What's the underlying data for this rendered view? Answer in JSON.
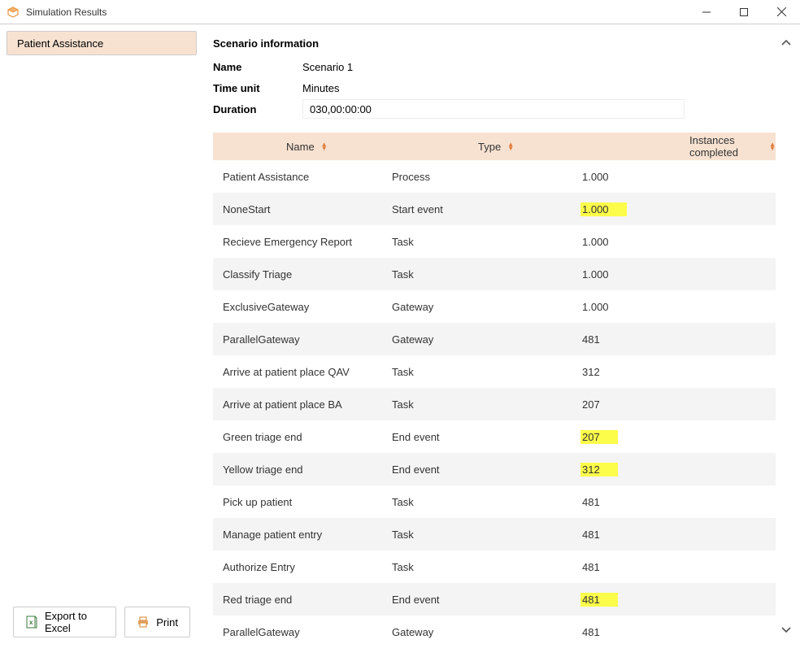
{
  "titlebar": {
    "title": "Simulation Results"
  },
  "sidebar": {
    "items": [
      {
        "label": "Patient Assistance",
        "selected": true
      }
    ]
  },
  "footer": {
    "export_label": "Export to Excel",
    "print_label": "Print"
  },
  "scenario": {
    "header": "Scenario information",
    "name_label": "Name",
    "name_value": "Scenario 1",
    "timeunit_label": "Time unit",
    "timeunit_value": "Minutes",
    "duration_label": "Duration",
    "duration_value": "030,00:00:00"
  },
  "table": {
    "headers": {
      "name": "Name",
      "type": "Type",
      "instances": "Instances completed"
    },
    "rows": [
      {
        "name": "Patient Assistance",
        "type": "Process",
        "instances": "1.000",
        "highlight": false
      },
      {
        "name": "NoneStart",
        "type": "Start event",
        "instances": "1.000",
        "highlight": true
      },
      {
        "name": "Recieve Emergency Report",
        "type": "Task",
        "instances": "1.000",
        "highlight": false
      },
      {
        "name": "Classify Triage",
        "type": "Task",
        "instances": "1.000",
        "highlight": false
      },
      {
        "name": "ExclusiveGateway",
        "type": "Gateway",
        "instances": "1.000",
        "highlight": false
      },
      {
        "name": "ParallelGateway",
        "type": "Gateway",
        "instances": "481",
        "highlight": false
      },
      {
        "name": "Arrive at patient place QAV",
        "type": "Task",
        "instances": "312",
        "highlight": false
      },
      {
        "name": "Arrive at patient place BA",
        "type": "Task",
        "instances": "207",
        "highlight": false
      },
      {
        "name": "Green triage end",
        "type": "End event",
        "instances": "207",
        "highlight": true
      },
      {
        "name": "Yellow triage end",
        "type": "End event",
        "instances": "312",
        "highlight": true
      },
      {
        "name": "Pick up patient",
        "type": "Task",
        "instances": "481",
        "highlight": false
      },
      {
        "name": "Manage patient entry",
        "type": "Task",
        "instances": "481",
        "highlight": false
      },
      {
        "name": "Authorize Entry",
        "type": "Task",
        "instances": "481",
        "highlight": false
      },
      {
        "name": "Red triage end",
        "type": "End event",
        "instances": "481",
        "highlight": true
      },
      {
        "name": "ParallelGateway",
        "type": "Gateway",
        "instances": "481",
        "highlight": false
      }
    ]
  }
}
